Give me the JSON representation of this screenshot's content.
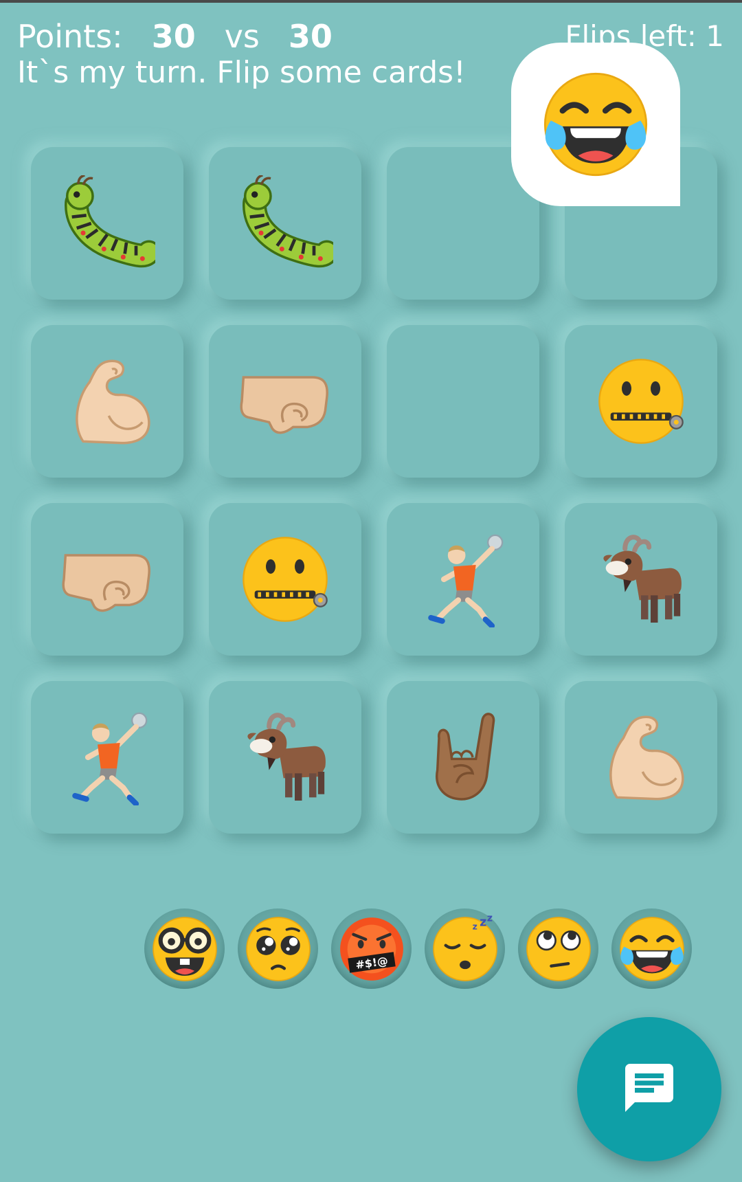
{
  "header": {
    "points_label": "Points:",
    "score_player": "30",
    "vs_label": "vs",
    "score_opponent": "30",
    "status_text": "It`s my turn. Flip some cards!",
    "flips_left_text": "Flips left: 1"
  },
  "opponent_reaction": {
    "emoji": "face-with-tears-of-joy"
  },
  "board": {
    "cards": [
      {
        "state": "face-up",
        "emoji": "caterpillar"
      },
      {
        "state": "face-up",
        "emoji": "caterpillar"
      },
      {
        "state": "face-down",
        "emoji": ""
      },
      {
        "state": "face-down",
        "emoji": ""
      },
      {
        "state": "face-up",
        "emoji": "flexed-biceps"
      },
      {
        "state": "face-up",
        "emoji": "left-facing-fist"
      },
      {
        "state": "face-down",
        "emoji": ""
      },
      {
        "state": "face-up",
        "emoji": "zipper-mouth-face"
      },
      {
        "state": "face-up",
        "emoji": "left-facing-fist"
      },
      {
        "state": "face-up",
        "emoji": "zipper-mouth-face"
      },
      {
        "state": "face-up",
        "emoji": "person-playing-handball"
      },
      {
        "state": "face-up",
        "emoji": "goat"
      },
      {
        "state": "face-up",
        "emoji": "person-playing-handball"
      },
      {
        "state": "face-up",
        "emoji": "goat"
      },
      {
        "state": "face-up",
        "emoji": "sign-of-the-horns"
      },
      {
        "state": "face-up",
        "emoji": "flexed-biceps"
      }
    ]
  },
  "reactions": [
    {
      "emoji": "nerd-face"
    },
    {
      "emoji": "pleading-face"
    },
    {
      "emoji": "face-with-symbols-on-mouth",
      "text": "#$!@"
    },
    {
      "emoji": "sleeping-face"
    },
    {
      "emoji": "face-with-rolling-eyes"
    },
    {
      "emoji": "face-with-tears-of-joy"
    }
  ],
  "chat_button": {
    "icon": "chat-icon"
  },
  "colors": {
    "background": "#7fc2c0",
    "card": "#79bdbb",
    "fab": "#0f9fa7",
    "text": "#ffffff"
  }
}
